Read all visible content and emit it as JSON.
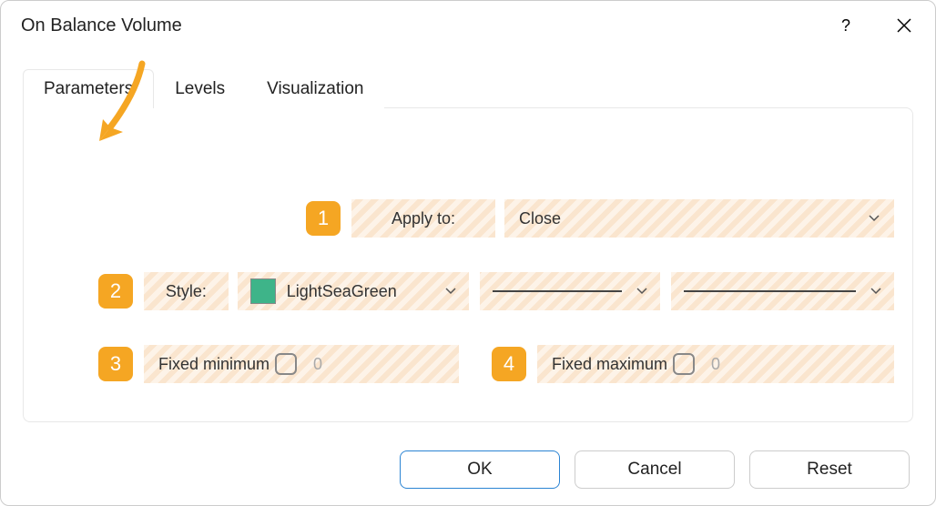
{
  "window": {
    "title": "On Balance Volume"
  },
  "tabs": {
    "parameters": "Parameters",
    "levels": "Levels",
    "visualization": "Visualization"
  },
  "labels": {
    "applyTo": "Apply to:",
    "style": "Style:",
    "fixedMin": "Fixed minimum",
    "fixedMax": "Fixed maximum"
  },
  "values": {
    "applyTo": "Close",
    "colorName": "LightSeaGreen",
    "colorHex": "#3EB489",
    "minValue": "0",
    "maxValue": "0"
  },
  "badges": {
    "b1": "1",
    "b2": "2",
    "b3": "3",
    "b4": "4"
  },
  "buttons": {
    "ok": "OK",
    "cancel": "Cancel",
    "reset": "Reset"
  }
}
